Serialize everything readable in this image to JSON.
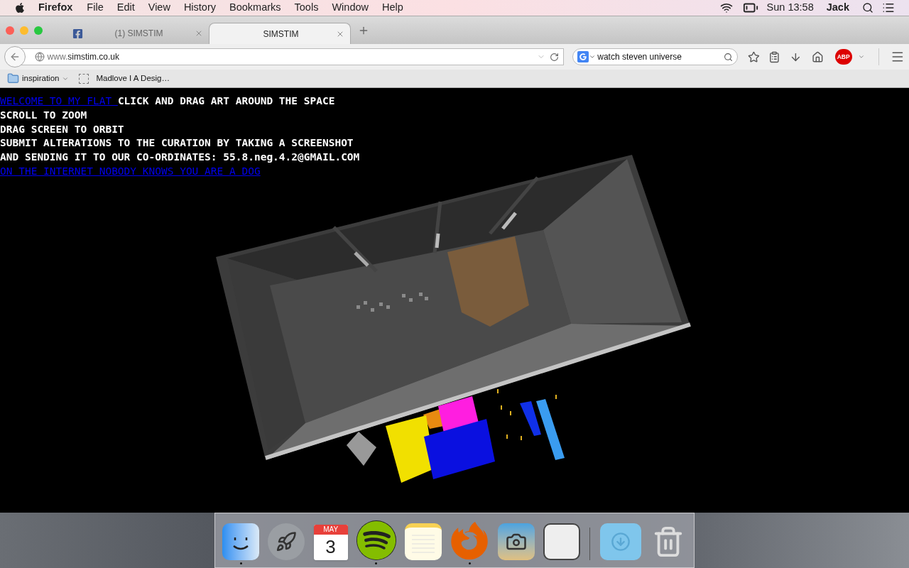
{
  "menu_bar": {
    "app": "Firefox",
    "menus": [
      "File",
      "Edit",
      "View",
      "History",
      "Bookmarks",
      "Tools",
      "Window",
      "Help"
    ],
    "clock": "Sun 13:58",
    "user": "Jack"
  },
  "tabs": [
    {
      "label": "(1) SIMSTIM",
      "selected": false,
      "has_icon": true
    },
    {
      "label": "SIMSTIM",
      "selected": true,
      "has_icon": false
    }
  ],
  "toolbar": {
    "url_host_prefix": "www.",
    "url_host": "simstim.co.uk",
    "search_value": "watch steven universe",
    "adblock_label": "ABP"
  },
  "bookmarks": [
    {
      "label": "inspiration",
      "kind": "folder"
    },
    {
      "label": "Madlove I A Desig…",
      "kind": "page"
    }
  ],
  "page": {
    "lines": [
      {
        "link": "WELCOME TO MY FLAT ",
        "text": "CLICK AND DRAG ART AROUND THE SPACE"
      },
      {
        "text": "SCROLL TO ZOOM"
      },
      {
        "text": "DRAG SCREEN TO ORBIT"
      },
      {
        "text": "SUBMIT ALTERATIONS TO THE CURATION BY TAKING A SCREENSHOT"
      },
      {
        "text": "AND SENDING IT TO OUR CO-ORDINATES: 55.8.neg.4.2@GMAIL.COM"
      },
      {
        "link": "ON THE INTERNET NOBODY KNOWS YOU ARE A DOG"
      }
    ]
  },
  "dock": {
    "items": [
      {
        "kind": "finder",
        "running": true
      },
      {
        "kind": "launchpad",
        "running": false
      },
      {
        "kind": "calendar",
        "running": false,
        "month": "MAY",
        "day": "3"
      },
      {
        "kind": "spotify",
        "running": true
      },
      {
        "kind": "notes",
        "running": false
      },
      {
        "kind": "firefox",
        "running": true
      },
      {
        "kind": "photos",
        "running": false
      },
      {
        "kind": "document",
        "running": false
      },
      {
        "kind": "separator"
      },
      {
        "kind": "downloads",
        "running": false
      },
      {
        "kind": "trash",
        "running": false
      }
    ]
  }
}
